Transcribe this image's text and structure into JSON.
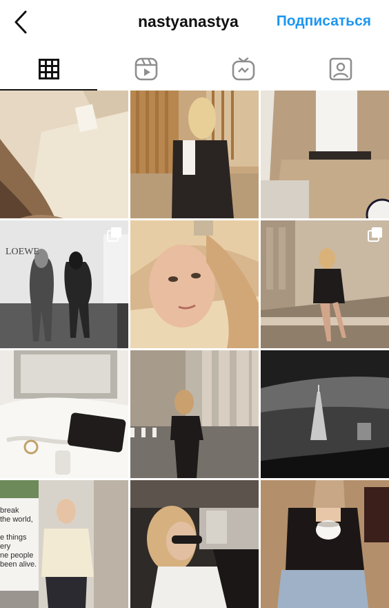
{
  "header": {
    "username": "nastyanastya",
    "follow_label": "Подписаться"
  },
  "tabs": [
    {
      "name": "grid",
      "icon": "grid-icon",
      "active": true
    },
    {
      "name": "reels",
      "icon": "reels-icon",
      "active": false
    },
    {
      "name": "igtv",
      "icon": "igtv-icon",
      "active": false
    },
    {
      "name": "tagged",
      "icon": "tagged-icon",
      "active": false
    }
  ],
  "posts": [
    {
      "id": 1,
      "multiple": false
    },
    {
      "id": 2,
      "multiple": false
    },
    {
      "id": 3,
      "multiple": false
    },
    {
      "id": 4,
      "multiple": true,
      "overlay_text": "LOEWE"
    },
    {
      "id": 5,
      "multiple": false
    },
    {
      "id": 6,
      "multiple": true
    },
    {
      "id": 7,
      "multiple": false
    },
    {
      "id": 8,
      "multiple": false
    },
    {
      "id": 9,
      "multiple": false
    },
    {
      "id": 10,
      "multiple": false,
      "overlay_text": "break\nthe world,\n\ne things\nery\nne people\nbeen alive."
    },
    {
      "id": 11,
      "multiple": false
    },
    {
      "id": 12,
      "multiple": false
    }
  ],
  "colors": {
    "accent": "#1d96f0",
    "text": "#111111"
  }
}
